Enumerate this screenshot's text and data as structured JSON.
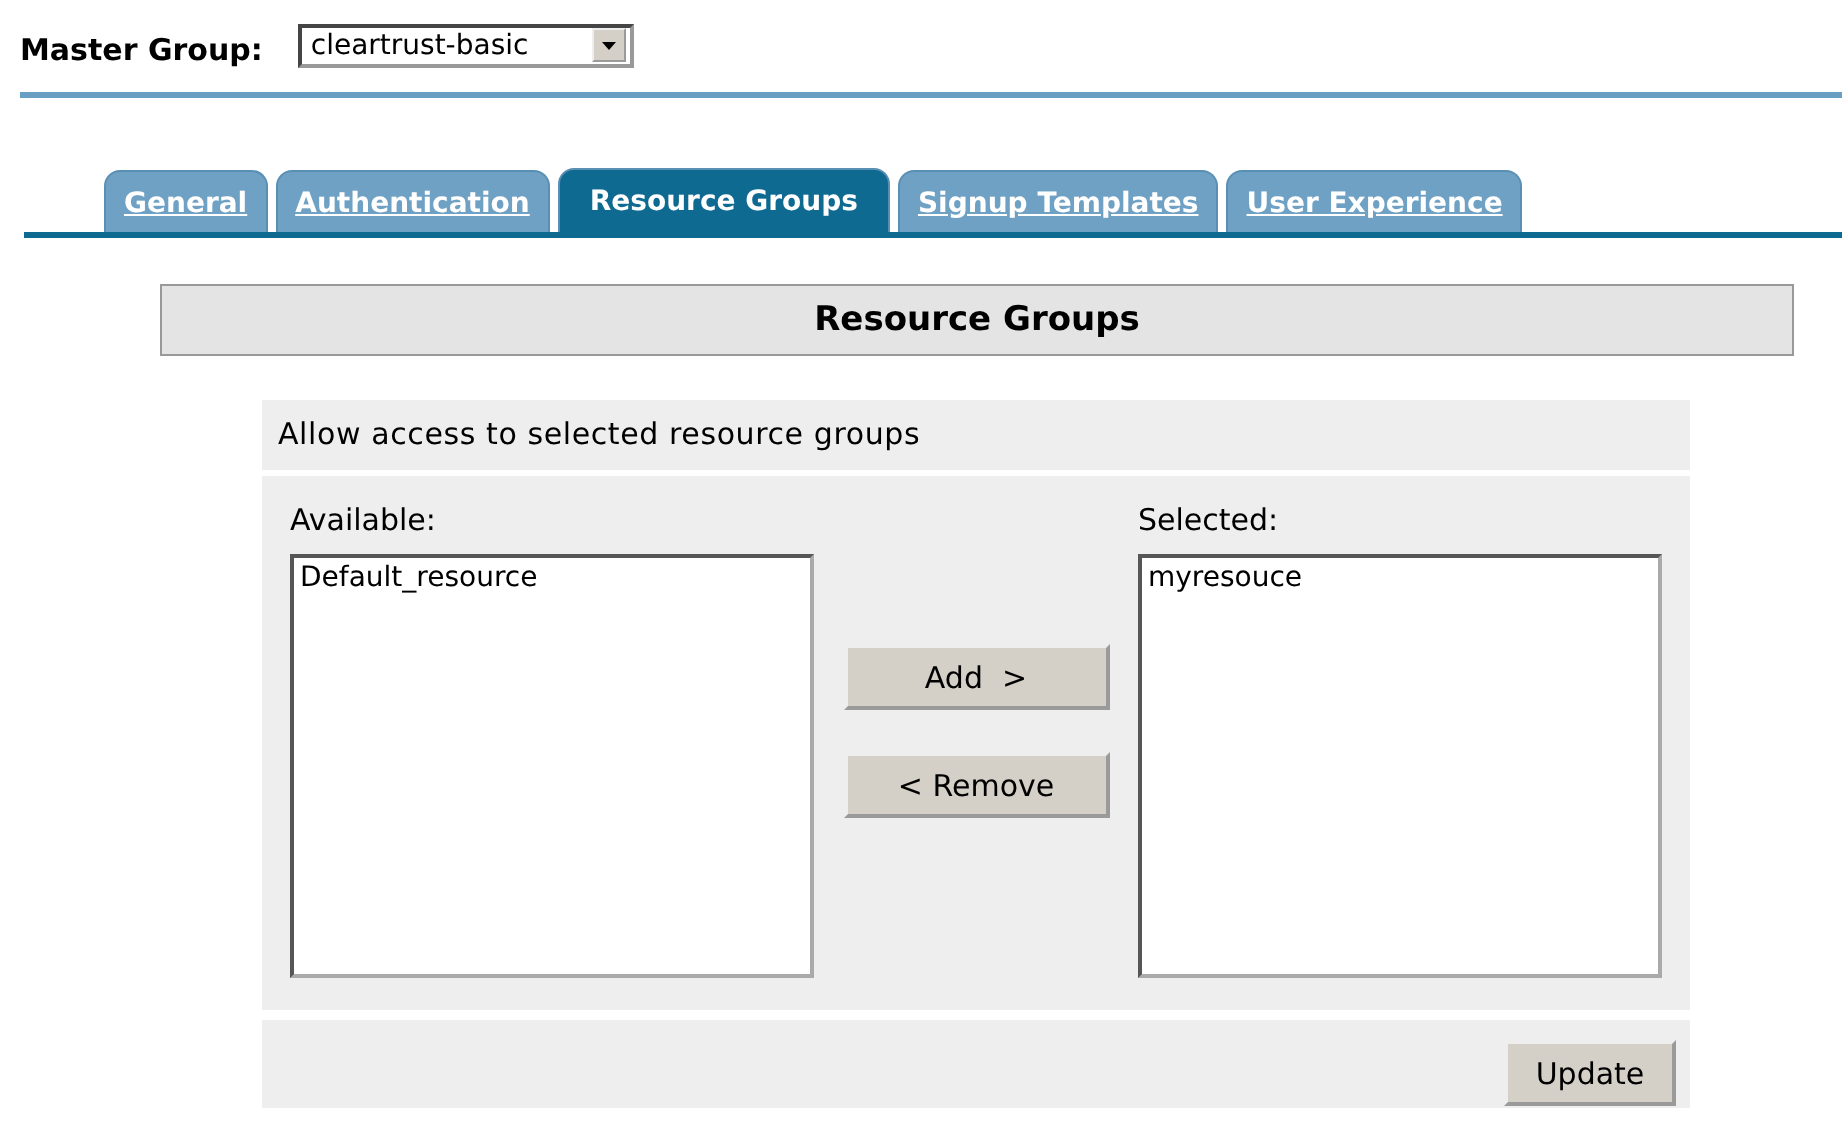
{
  "master_group": {
    "label": "Master Group:",
    "value": "cleartrust-basic"
  },
  "tabs": [
    {
      "label": "General",
      "selected": false
    },
    {
      "label": "Authentication",
      "selected": false
    },
    {
      "label": "Resource Groups",
      "selected": true
    },
    {
      "label": "Signup Templates",
      "selected": false
    },
    {
      "label": "User Experience",
      "selected": false
    }
  ],
  "section_title": "Resource Groups",
  "instruction": "Allow access to selected resource groups",
  "available": {
    "label": "Available:",
    "items": [
      "Default_resource"
    ]
  },
  "selected": {
    "label": "Selected:",
    "items": [
      "myresouce"
    ]
  },
  "buttons": {
    "add": "Add  >",
    "remove": "< Remove",
    "update": "Update"
  }
}
